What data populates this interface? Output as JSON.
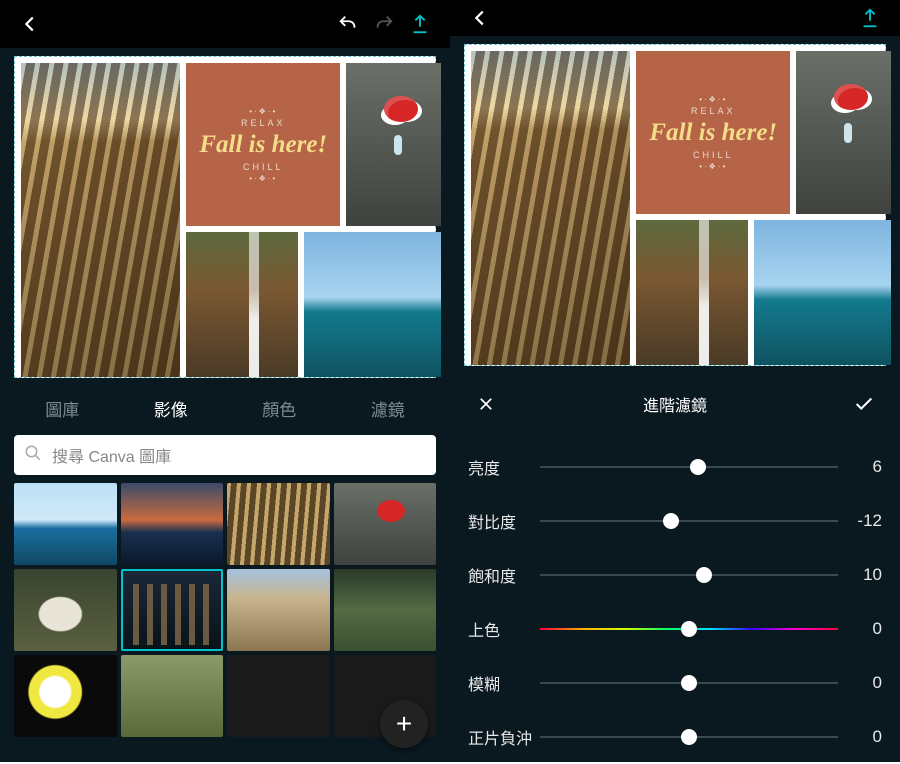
{
  "canvas_text": {
    "relax": "RELAX",
    "headline": "Fall is here!",
    "chill": "CHILL"
  },
  "left_screen": {
    "tabs": [
      "圖庫",
      "影像",
      "顏色",
      "濾鏡"
    ],
    "active_tab_index": 1,
    "search_placeholder": "搜尋 Canva 圖庫"
  },
  "right_screen": {
    "panel_title": "進階濾鏡",
    "sliders": [
      {
        "label": "亮度",
        "value": 6,
        "pos": 53,
        "rainbow": false
      },
      {
        "label": "對比度",
        "value": -12,
        "pos": 44,
        "rainbow": false
      },
      {
        "label": "飽和度",
        "value": 10,
        "pos": 55,
        "rainbow": false
      },
      {
        "label": "上色",
        "value": 0,
        "pos": 50,
        "rainbow": true
      },
      {
        "label": "模糊",
        "value": 0,
        "pos": 50,
        "rainbow": false
      },
      {
        "label": "正片負沖",
        "value": 0,
        "pos": 50,
        "rainbow": false
      }
    ]
  }
}
